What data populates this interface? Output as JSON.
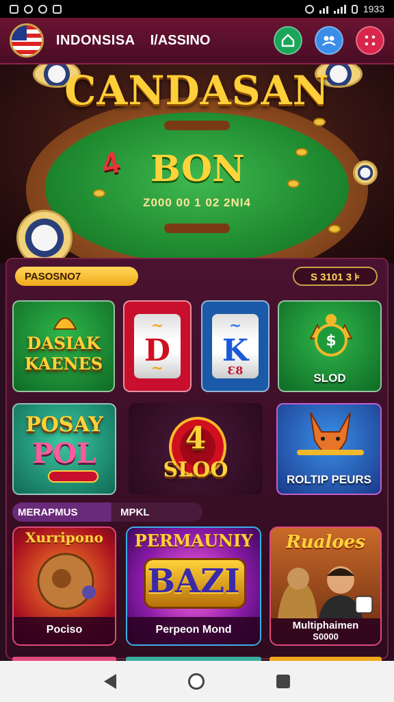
{
  "status_bar": {
    "time": "1933"
  },
  "header": {
    "brand": "INDONSISA",
    "brand_secondary": "I/ASSINO",
    "icons": [
      "flag-icon",
      "home-icon",
      "users-icon",
      "menu-grid-icon"
    ]
  },
  "hero": {
    "title": "CANDASAN",
    "badge_number": "4",
    "banner_text": "BON",
    "date_text": "Z000 00 1 02 2NI4"
  },
  "filters": {
    "left_pill": "PASOSNO7",
    "right_pill": "S 3101 3 ⊧"
  },
  "tiles": [
    {
      "title": "DASIAK KAENES",
      "caption": ""
    },
    {
      "reel_symbol": "D",
      "caption": ""
    },
    {
      "reel_symbol": "K",
      "bottom_symbol": "Ɛ8",
      "caption": ""
    },
    {
      "caption": "SLOD"
    },
    {
      "title_top": "POSAY",
      "title_bottom": "POL",
      "caption": ""
    },
    {
      "number": "4",
      "title": "SLOO",
      "caption": ""
    },
    {
      "caption": "ROLTIP PEURS"
    }
  ],
  "section": {
    "tab_active": "MERAPMUS",
    "tab_other": "MPKL"
  },
  "cards": [
    {
      "top_label": "Xurripono",
      "bottom_label": "Pociso"
    },
    {
      "top_label": "PERMAUNIY",
      "center_label": "BAZI",
      "bottom_label": "Perpeon Mond"
    },
    {
      "top_label": "Rualoes",
      "bottom_label": "Multiphaimen",
      "bottom_sub": "S0000"
    }
  ],
  "colors": {
    "background": "#2a0d1f",
    "header": "#6a1433",
    "accent_gold": "#ffd23a",
    "felt_green": "#1f8a30",
    "card_border": "#e04a7a"
  }
}
